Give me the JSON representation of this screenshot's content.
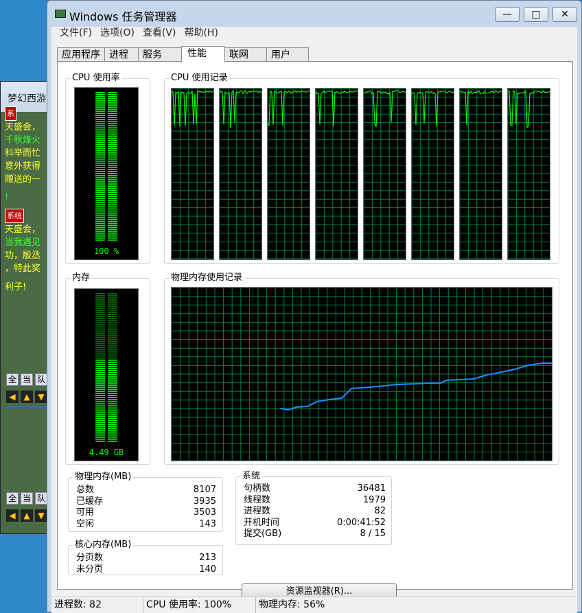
{
  "background": {
    "window_title": "梦幻西游",
    "chat": [
      "天盛会，",
      "千秋烽火",
      "科举而忙",
      "意外获得",
      "赠送的一",
      "!",
      "天盛会，",
      "当我遇见",
      "功，殷丞",
      "，特此奖",
      "利子!"
    ],
    "tags": [
      "系",
      "系统"
    ],
    "buttons": [
      "全",
      "当",
      "队"
    ],
    "arrows": [
      "◀",
      "▲",
      "▼"
    ]
  },
  "window": {
    "title": "Windows 任务管理器",
    "controls": {
      "min": "—",
      "max": "□",
      "close": "✕"
    }
  },
  "menu": [
    "文件(F)",
    "选项(O)",
    "查看(V)",
    "帮助(H)"
  ],
  "tabs": [
    {
      "label": "应用程序",
      "active": false
    },
    {
      "label": "进程",
      "active": false
    },
    {
      "label": "服务",
      "active": false
    },
    {
      "label": "性能",
      "active": true
    },
    {
      "label": "联网",
      "active": false
    },
    {
      "label": "用户",
      "active": false
    }
  ],
  "performance": {
    "cpu_usage_label": "CPU 使用率",
    "cpu_usage_value": "100 %",
    "cpu_usage_fraction": 1.0,
    "cpu_history_label": "CPU 使用记录",
    "memory_label": "内存",
    "memory_value": "4.49 GB",
    "memory_fraction": 0.56,
    "memory_history_label": "物理内存使用记录",
    "cpu_core_count": 8
  },
  "physical_memory": {
    "label": "物理内存(MB)",
    "rows": [
      {
        "name": "总数",
        "value": "8107"
      },
      {
        "name": "已缓存",
        "value": "3935"
      },
      {
        "name": "可用",
        "value": "3503"
      },
      {
        "name": "空闲",
        "value": "143"
      }
    ]
  },
  "kernel_memory": {
    "label": "核心内存(MB)",
    "rows": [
      {
        "name": "分页数",
        "value": "213"
      },
      {
        "name": "未分页",
        "value": "140"
      }
    ]
  },
  "system": {
    "label": "系统",
    "rows": [
      {
        "name": "句柄数",
        "value": "36481"
      },
      {
        "name": "线程数",
        "value": "1979"
      },
      {
        "name": "进程数",
        "value": "82"
      },
      {
        "name": "开机时间",
        "value": "0:00:41:52"
      },
      {
        "name": "提交(GB)",
        "value": "8 / 15"
      }
    ]
  },
  "resource_monitor_button": "资源监视器(R)...",
  "statusbar": {
    "processes": "进程数: 82",
    "cpu": "CPU 使用率: 100%",
    "memory": "物理内存: 56%"
  },
  "colors": {
    "graph_grid": "#008040",
    "cpu_line": "#00ff00",
    "memory_line": "#1e90ff"
  }
}
